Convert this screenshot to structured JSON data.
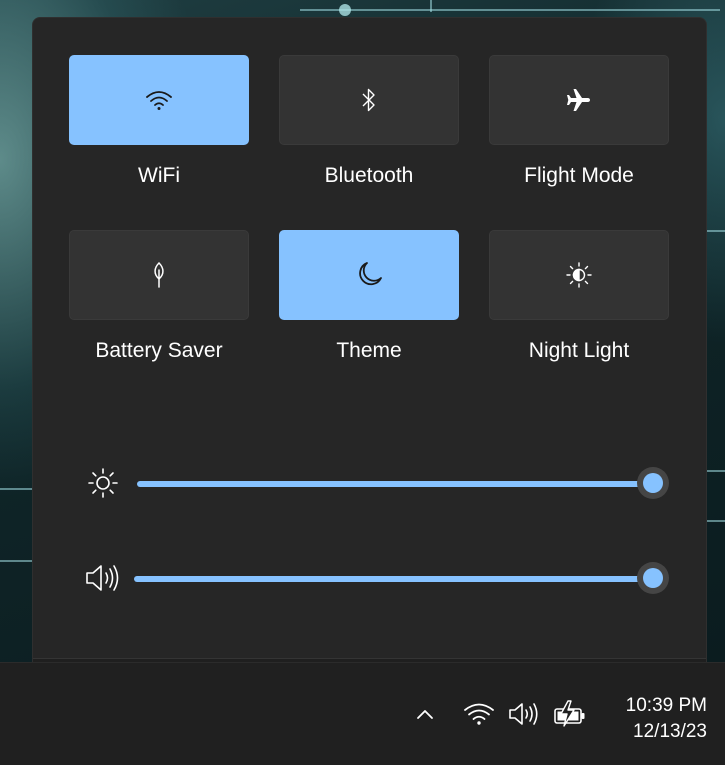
{
  "quick_settings": {
    "tiles": [
      {
        "label": "WiFi",
        "icon": "wifi-icon",
        "active": true
      },
      {
        "label": "Bluetooth",
        "icon": "bluetooth-icon",
        "active": false
      },
      {
        "label": "Flight Mode",
        "icon": "airplane-icon",
        "active": false
      },
      {
        "label": "Battery Saver",
        "icon": "leaf-icon",
        "active": false
      },
      {
        "label": "Theme",
        "icon": "moon-icon",
        "active": true
      },
      {
        "label": "Night Light",
        "icon": "night-light-icon",
        "active": false
      }
    ],
    "brightness": {
      "icon": "sun-icon",
      "level": 1.0
    },
    "volume": {
      "icon": "speaker-icon",
      "level": 1.0
    }
  },
  "taskbar": {
    "tray_icons": [
      "chevron-up-icon",
      "wifi-icon",
      "speaker-icon",
      "battery-charging-icon"
    ],
    "time": "10:39 PM",
    "date": "12/13/23"
  },
  "colors": {
    "accent": "#86c2ff",
    "panel_bg": "#262626",
    "tile_bg": "#333333",
    "taskbar_bg": "#202020"
  }
}
